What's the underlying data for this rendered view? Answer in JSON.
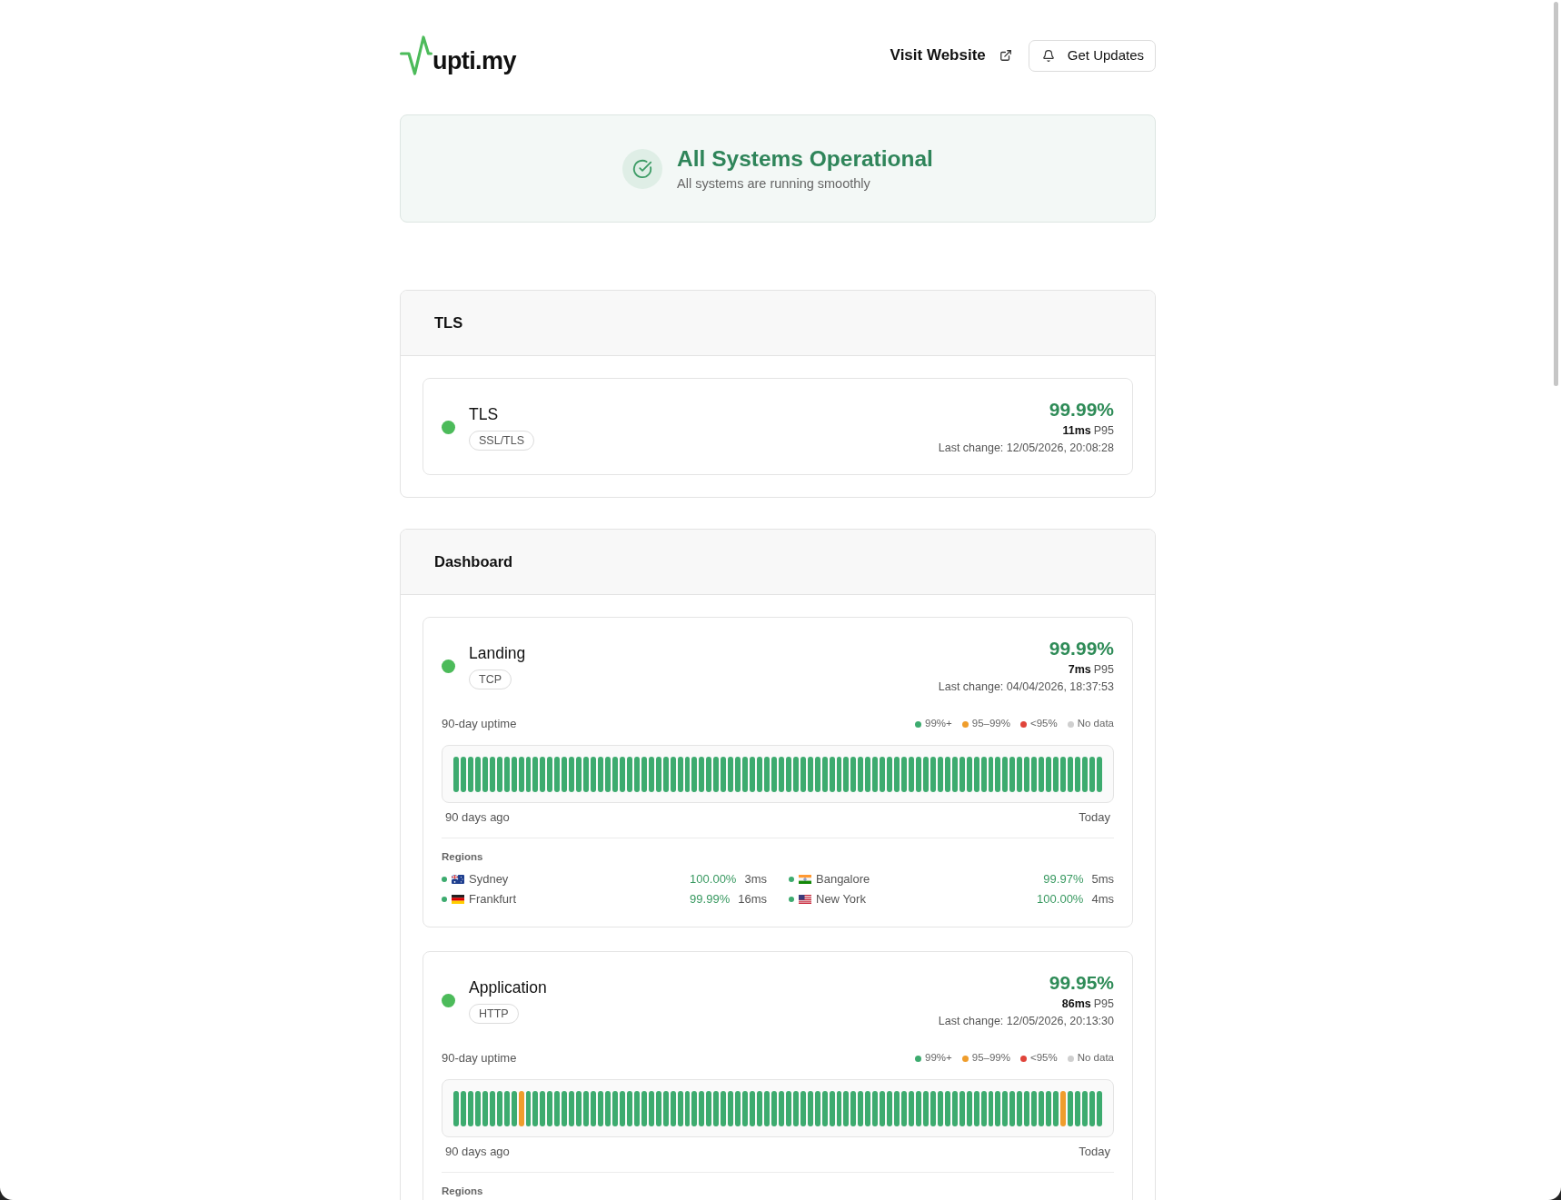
{
  "header": {
    "logo_text": "upti.my",
    "visit_link": "Visit Website",
    "updates_button": "Get Updates"
  },
  "banner": {
    "title": "All Systems Operational",
    "subtitle": "All systems are running smoothly"
  },
  "groups": [
    {
      "title": "TLS",
      "monitors": [
        {
          "name": "TLS",
          "protocol": "SSL/TLS",
          "color": "#4cbb5a",
          "uptime": "99.99%",
          "latency": "11ms",
          "latency_label": "P95",
          "last_change": "Last change: 12/05/2026, 20:08:28"
        }
      ]
    },
    {
      "title": "Dashboard",
      "monitors": [
        {
          "name": "Landing",
          "protocol": "TCP",
          "color": "#4cbb5a",
          "uptime": "99.99%",
          "latency": "7ms",
          "latency_label": "P95",
          "last_change": "Last change: 04/04/2026, 18:37:53",
          "history": {
            "label": "90-day uptime",
            "legend": [
              {
                "label": "99%+",
                "color": "#3dab6f"
              },
              {
                "label": "95–99%",
                "color": "#ef9d2c"
              },
              {
                "label": "<95%",
                "color": "#e0443a"
              },
              {
                "label": "No data",
                "color": "#cfcfcf"
              }
            ],
            "bars": [
              {
                "color": "#3dab6f"
              },
              {
                "color": "#3dab6f"
              },
              {
                "color": "#3dab6f"
              },
              {
                "color": "#3dab6f"
              },
              {
                "color": "#3dab6f"
              },
              {
                "color": "#3dab6f"
              },
              {
                "color": "#3dab6f"
              },
              {
                "color": "#3dab6f"
              },
              {
                "color": "#3dab6f"
              },
              {
                "color": "#3dab6f"
              },
              {
                "color": "#3dab6f"
              },
              {
                "color": "#3dab6f"
              },
              {
                "color": "#3dab6f"
              },
              {
                "color": "#3dab6f"
              },
              {
                "color": "#3dab6f"
              },
              {
                "color": "#3dab6f"
              },
              {
                "color": "#3dab6f"
              },
              {
                "color": "#3dab6f"
              },
              {
                "color": "#3dab6f"
              },
              {
                "color": "#3dab6f"
              },
              {
                "color": "#3dab6f"
              },
              {
                "color": "#3dab6f"
              },
              {
                "color": "#3dab6f"
              },
              {
                "color": "#3dab6f"
              },
              {
                "color": "#3dab6f"
              },
              {
                "color": "#3dab6f"
              },
              {
                "color": "#3dab6f"
              },
              {
                "color": "#3dab6f"
              },
              {
                "color": "#3dab6f"
              },
              {
                "color": "#3dab6f"
              },
              {
                "color": "#3dab6f"
              },
              {
                "color": "#3dab6f"
              },
              {
                "color": "#3dab6f"
              },
              {
                "color": "#3dab6f"
              },
              {
                "color": "#3dab6f"
              },
              {
                "color": "#3dab6f"
              },
              {
                "color": "#3dab6f"
              },
              {
                "color": "#3dab6f"
              },
              {
                "color": "#3dab6f"
              },
              {
                "color": "#3dab6f"
              },
              {
                "color": "#3dab6f"
              },
              {
                "color": "#3dab6f"
              },
              {
                "color": "#3dab6f"
              },
              {
                "color": "#3dab6f"
              },
              {
                "color": "#3dab6f"
              },
              {
                "color": "#3dab6f"
              },
              {
                "color": "#3dab6f"
              },
              {
                "color": "#3dab6f"
              },
              {
                "color": "#3dab6f"
              },
              {
                "color": "#3dab6f"
              },
              {
                "color": "#3dab6f"
              },
              {
                "color": "#3dab6f"
              },
              {
                "color": "#3dab6f"
              },
              {
                "color": "#3dab6f"
              },
              {
                "color": "#3dab6f"
              },
              {
                "color": "#3dab6f"
              },
              {
                "color": "#3dab6f"
              },
              {
                "color": "#3dab6f"
              },
              {
                "color": "#3dab6f"
              },
              {
                "color": "#3dab6f"
              },
              {
                "color": "#3dab6f"
              },
              {
                "color": "#3dab6f"
              },
              {
                "color": "#3dab6f"
              },
              {
                "color": "#3dab6f"
              },
              {
                "color": "#3dab6f"
              },
              {
                "color": "#3dab6f"
              },
              {
                "color": "#3dab6f"
              },
              {
                "color": "#3dab6f"
              },
              {
                "color": "#3dab6f"
              },
              {
                "color": "#3dab6f"
              },
              {
                "color": "#3dab6f"
              },
              {
                "color": "#3dab6f"
              },
              {
                "color": "#3dab6f"
              },
              {
                "color": "#3dab6f"
              },
              {
                "color": "#3dab6f"
              },
              {
                "color": "#3dab6f"
              },
              {
                "color": "#3dab6f"
              },
              {
                "color": "#3dab6f"
              },
              {
                "color": "#3dab6f"
              },
              {
                "color": "#3dab6f"
              },
              {
                "color": "#3dab6f"
              },
              {
                "color": "#3dab6f"
              },
              {
                "color": "#3dab6f"
              },
              {
                "color": "#3dab6f"
              },
              {
                "color": "#3dab6f"
              },
              {
                "color": "#3dab6f"
              },
              {
                "color": "#3dab6f"
              },
              {
                "color": "#3dab6f"
              },
              {
                "color": "#3dab6f"
              },
              {
                "color": "#3dab6f"
              }
            ],
            "start_label": "90 days ago",
            "end_label": "Today"
          },
          "regions": {
            "label": "Regions",
            "items": [
              {
                "kind": "australia",
                "name": "Sydney",
                "color": "#3dab6f",
                "uptime": "100.00%",
                "latency": "3ms"
              },
              {
                "kind": "india",
                "name": "Bangalore",
                "color": "#3dab6f",
                "uptime": "99.97%",
                "latency": "5ms"
              },
              {
                "kind": "germany",
                "name": "Frankfurt",
                "color": "#3dab6f",
                "uptime": "99.99%",
                "latency": "16ms"
              },
              {
                "kind": "usa",
                "name": "New York",
                "color": "#3dab6f",
                "uptime": "100.00%",
                "latency": "4ms"
              }
            ]
          }
        },
        {
          "name": "Application",
          "protocol": "HTTP",
          "color": "#4cbb5a",
          "uptime": "99.95%",
          "latency": "86ms",
          "latency_label": "P95",
          "last_change": "Last change: 12/05/2026, 20:13:30",
          "history": {
            "label": "90-day uptime",
            "legend": [
              {
                "label": "99%+",
                "color": "#3dab6f"
              },
              {
                "label": "95–99%",
                "color": "#ef9d2c"
              },
              {
                "label": "<95%",
                "color": "#e0443a"
              },
              {
                "label": "No data",
                "color": "#cfcfcf"
              }
            ],
            "bars": [
              {
                "color": "#3dab6f"
              },
              {
                "color": "#3dab6f"
              },
              {
                "color": "#3dab6f"
              },
              {
                "color": "#3dab6f"
              },
              {
                "color": "#3dab6f"
              },
              {
                "color": "#3dab6f"
              },
              {
                "color": "#3dab6f"
              },
              {
                "color": "#3dab6f"
              },
              {
                "color": "#3dab6f"
              },
              {
                "color": "#ef9d2c"
              },
              {
                "color": "#3dab6f"
              },
              {
                "color": "#3dab6f"
              },
              {
                "color": "#3dab6f"
              },
              {
                "color": "#3dab6f"
              },
              {
                "color": "#3dab6f"
              },
              {
                "color": "#3dab6f"
              },
              {
                "color": "#3dab6f"
              },
              {
                "color": "#3dab6f"
              },
              {
                "color": "#3dab6f"
              },
              {
                "color": "#3dab6f"
              },
              {
                "color": "#3dab6f"
              },
              {
                "color": "#3dab6f"
              },
              {
                "color": "#3dab6f"
              },
              {
                "color": "#3dab6f"
              },
              {
                "color": "#3dab6f"
              },
              {
                "color": "#3dab6f"
              },
              {
                "color": "#3dab6f"
              },
              {
                "color": "#3dab6f"
              },
              {
                "color": "#3dab6f"
              },
              {
                "color": "#3dab6f"
              },
              {
                "color": "#3dab6f"
              },
              {
                "color": "#3dab6f"
              },
              {
                "color": "#3dab6f"
              },
              {
                "color": "#3dab6f"
              },
              {
                "color": "#3dab6f"
              },
              {
                "color": "#3dab6f"
              },
              {
                "color": "#3dab6f"
              },
              {
                "color": "#3dab6f"
              },
              {
                "color": "#3dab6f"
              },
              {
                "color": "#3dab6f"
              },
              {
                "color": "#3dab6f"
              },
              {
                "color": "#3dab6f"
              },
              {
                "color": "#3dab6f"
              },
              {
                "color": "#3dab6f"
              },
              {
                "color": "#3dab6f"
              },
              {
                "color": "#3dab6f"
              },
              {
                "color": "#3dab6f"
              },
              {
                "color": "#3dab6f"
              },
              {
                "color": "#3dab6f"
              },
              {
                "color": "#3dab6f"
              },
              {
                "color": "#3dab6f"
              },
              {
                "color": "#3dab6f"
              },
              {
                "color": "#3dab6f"
              },
              {
                "color": "#3dab6f"
              },
              {
                "color": "#3dab6f"
              },
              {
                "color": "#3dab6f"
              },
              {
                "color": "#3dab6f"
              },
              {
                "color": "#3dab6f"
              },
              {
                "color": "#3dab6f"
              },
              {
                "color": "#3dab6f"
              },
              {
                "color": "#3dab6f"
              },
              {
                "color": "#3dab6f"
              },
              {
                "color": "#3dab6f"
              },
              {
                "color": "#3dab6f"
              },
              {
                "color": "#3dab6f"
              },
              {
                "color": "#3dab6f"
              },
              {
                "color": "#3dab6f"
              },
              {
                "color": "#3dab6f"
              },
              {
                "color": "#3dab6f"
              },
              {
                "color": "#3dab6f"
              },
              {
                "color": "#3dab6f"
              },
              {
                "color": "#3dab6f"
              },
              {
                "color": "#3dab6f"
              },
              {
                "color": "#3dab6f"
              },
              {
                "color": "#3dab6f"
              },
              {
                "color": "#3dab6f"
              },
              {
                "color": "#3dab6f"
              },
              {
                "color": "#3dab6f"
              },
              {
                "color": "#3dab6f"
              },
              {
                "color": "#3dab6f"
              },
              {
                "color": "#3dab6f"
              },
              {
                "color": "#3dab6f"
              },
              {
                "color": "#3dab6f"
              },
              {
                "color": "#3dab6f"
              },
              {
                "color": "#ef9d2c"
              },
              {
                "color": "#3dab6f"
              },
              {
                "color": "#3dab6f"
              },
              {
                "color": "#3dab6f"
              },
              {
                "color": "#3dab6f"
              },
              {
                "color": "#3dab6f"
              }
            ],
            "start_label": "90 days ago",
            "end_label": "Today"
          },
          "regions": {
            "label": "Regions"
          }
        }
      ]
    }
  ]
}
